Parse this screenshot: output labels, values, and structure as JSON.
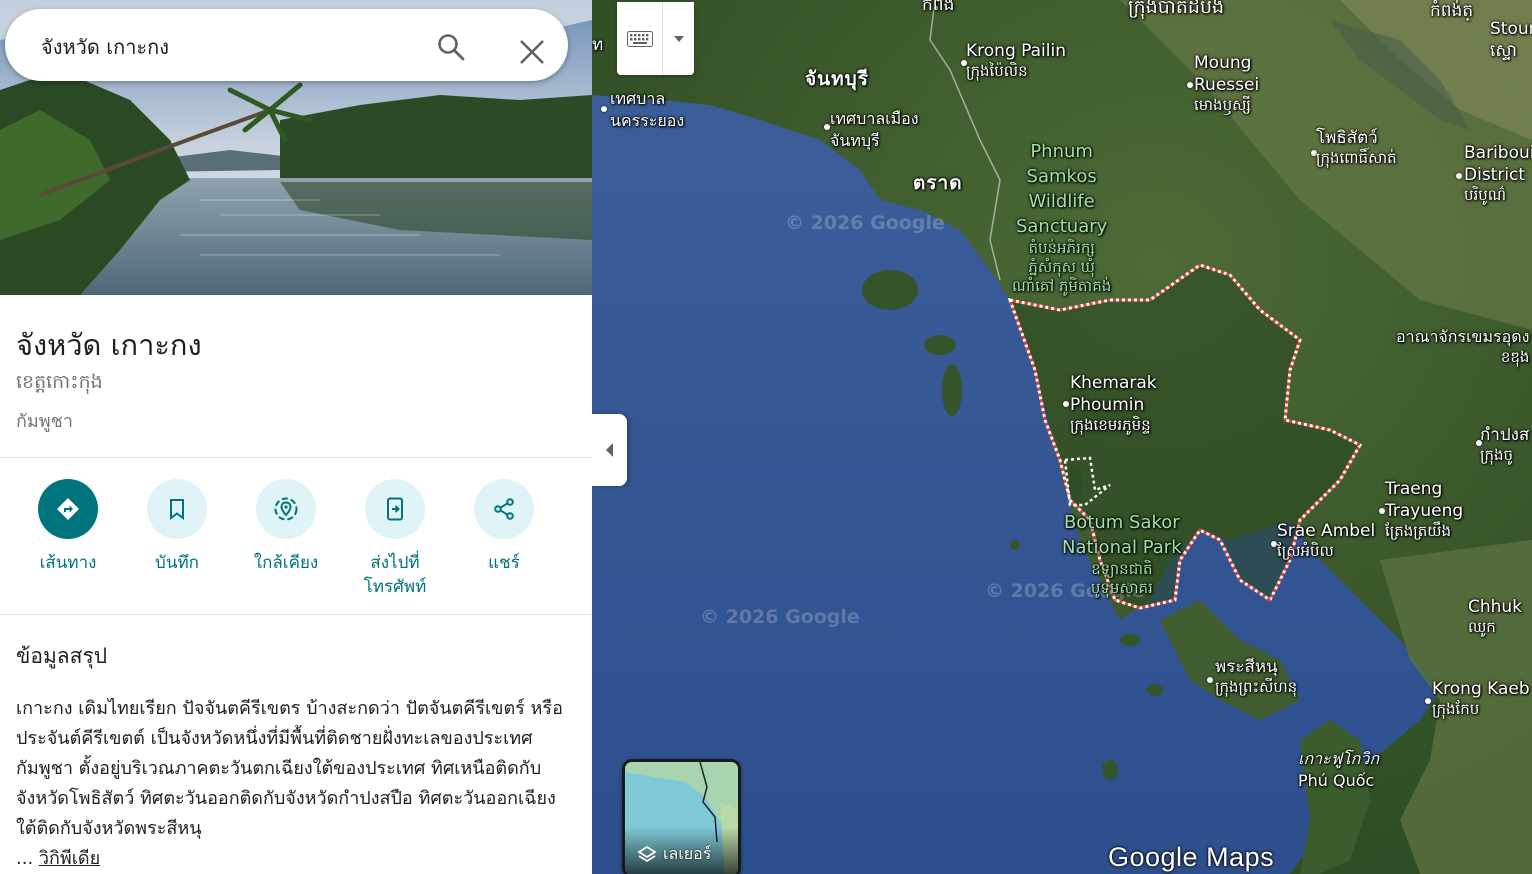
{
  "search": {
    "query": "จังหวัด เกาะกง"
  },
  "place": {
    "title": "จังหวัด เกาะกง",
    "native_name": "ខេត្តកោះកុង",
    "country": "กัมพูชา"
  },
  "actions": [
    {
      "label": "เส้นทาง",
      "icon": "directions-icon"
    },
    {
      "label": "บันทึก",
      "icon": "bookmark-icon"
    },
    {
      "label": "ใกล้เคียง",
      "icon": "nearby-icon"
    },
    {
      "label_line1": "ส่งไปที่",
      "label_line2": "โทรศัพท์",
      "icon": "send-to-phone-icon"
    },
    {
      "label": "แชร์",
      "icon": "share-icon"
    }
  ],
  "summary": {
    "heading": "ข้อมูลสรุป",
    "text": "เกาะกง เดิมไทยเรียก ปัจจันตคีรีเขตร บ้างสะกดว่า ปัตจันตคีรีเขตร์ หรือ ประจันต์คีรีเขตต์ เป็นจังหวัดหนึ่งที่มีพื้นที่ติดชายฝั่งทะเลของประเทศกัมพูชา ตั้งอยู่บริเวณภาคตะวันตกเฉียงใต้ของประเทศ ทิศเหนือติดกับจังหวัดโพธิสัตว์ ทิศตะวันออกติดกับจังหวัดกำปงสปือ ทิศตะวันออกเฉียงใต้ติดกับจังหวัดพระสีหนุ",
    "ellipsis": "...",
    "link": "วิกิพีเดีย"
  },
  "layers": {
    "label": "เลเยอร์"
  },
  "map": {
    "attribution": "Google Maps",
    "watermark": "© 2026 Google",
    "labels": {
      "top_clip1": "កំពង់",
      "top_clip2": "ក្រុងបាត់ដំបង",
      "top_clip3": "កំពង់ត្",
      "stour": "Stour",
      "stour_km": "ស្ទោ",
      "left_clip": "ท",
      "pailin": "Krong Pailin",
      "pailin_km": "ក្រុងប៉ៃលិន",
      "moung1": "Moung",
      "moung2": "Ruessei",
      "moung_km": "មោងឫស្សី",
      "chanthaburi": "จันทบุรี",
      "rayong1": "เทศบาล",
      "rayong2": "นครระยอง",
      "chanmuni1": "เทศบาลเมือง",
      "chanmuni2": "จันทบุรี",
      "trat": "ตราด",
      "phnum1": "Phnum",
      "phnum2": "Samkos",
      "phnum3": "Wildlife",
      "phnum4": "Sanctuary",
      "phnum_km1": "តំបន់អភិរក្ស",
      "phnum_km2": "ភ្នំសំកុស ឃុំ",
      "phnum_km3": "ណាំគៅ ភូមិតាគង់",
      "pursat": "โพธิสัตว์",
      "pursat_km": "ក្រុងពោធិ៍សាត់",
      "bariboe1": "Bariboui",
      "bariboe2": "District",
      "bariboe_km": "បរិបូណ៌",
      "cambodia": "อาณาจักรเขมรอุดง",
      "cambodia_km": "ខឌុង",
      "khemarak1": "Khemarak",
      "khemarak2": "Phoumin",
      "khemarak_km": "ក្រុងខេមរភូមិន្ទ",
      "kampong": "กำปงส",
      "kampong_km": "ក្រុងចូ",
      "traeng1": "Traeng",
      "traeng2": "Trayueng",
      "traeng_km": "ត្រែងត្រយឹង",
      "botum1": "Botum Sakor",
      "botum2": "National Park",
      "botum_km1": "ឧទ្យានជាតិ",
      "botum_km2": "បូទុមសាគរ",
      "srae": "Srae Ambel",
      "srae_km": "ស្រែអំបិល",
      "chhuk": "Chhuk",
      "chhuk_km": "ឈូក",
      "sihanouk": "พระสีหนุ",
      "sihanouk_km": "ក្រុងព្រះសីហនុ",
      "kaeb": "Krong Kaeb",
      "kaeb_km": "ក្រុងកែប",
      "phuquoc1": "เกาะฟูโกวิก",
      "phuquoc2": "Phú Quốc"
    }
  }
}
